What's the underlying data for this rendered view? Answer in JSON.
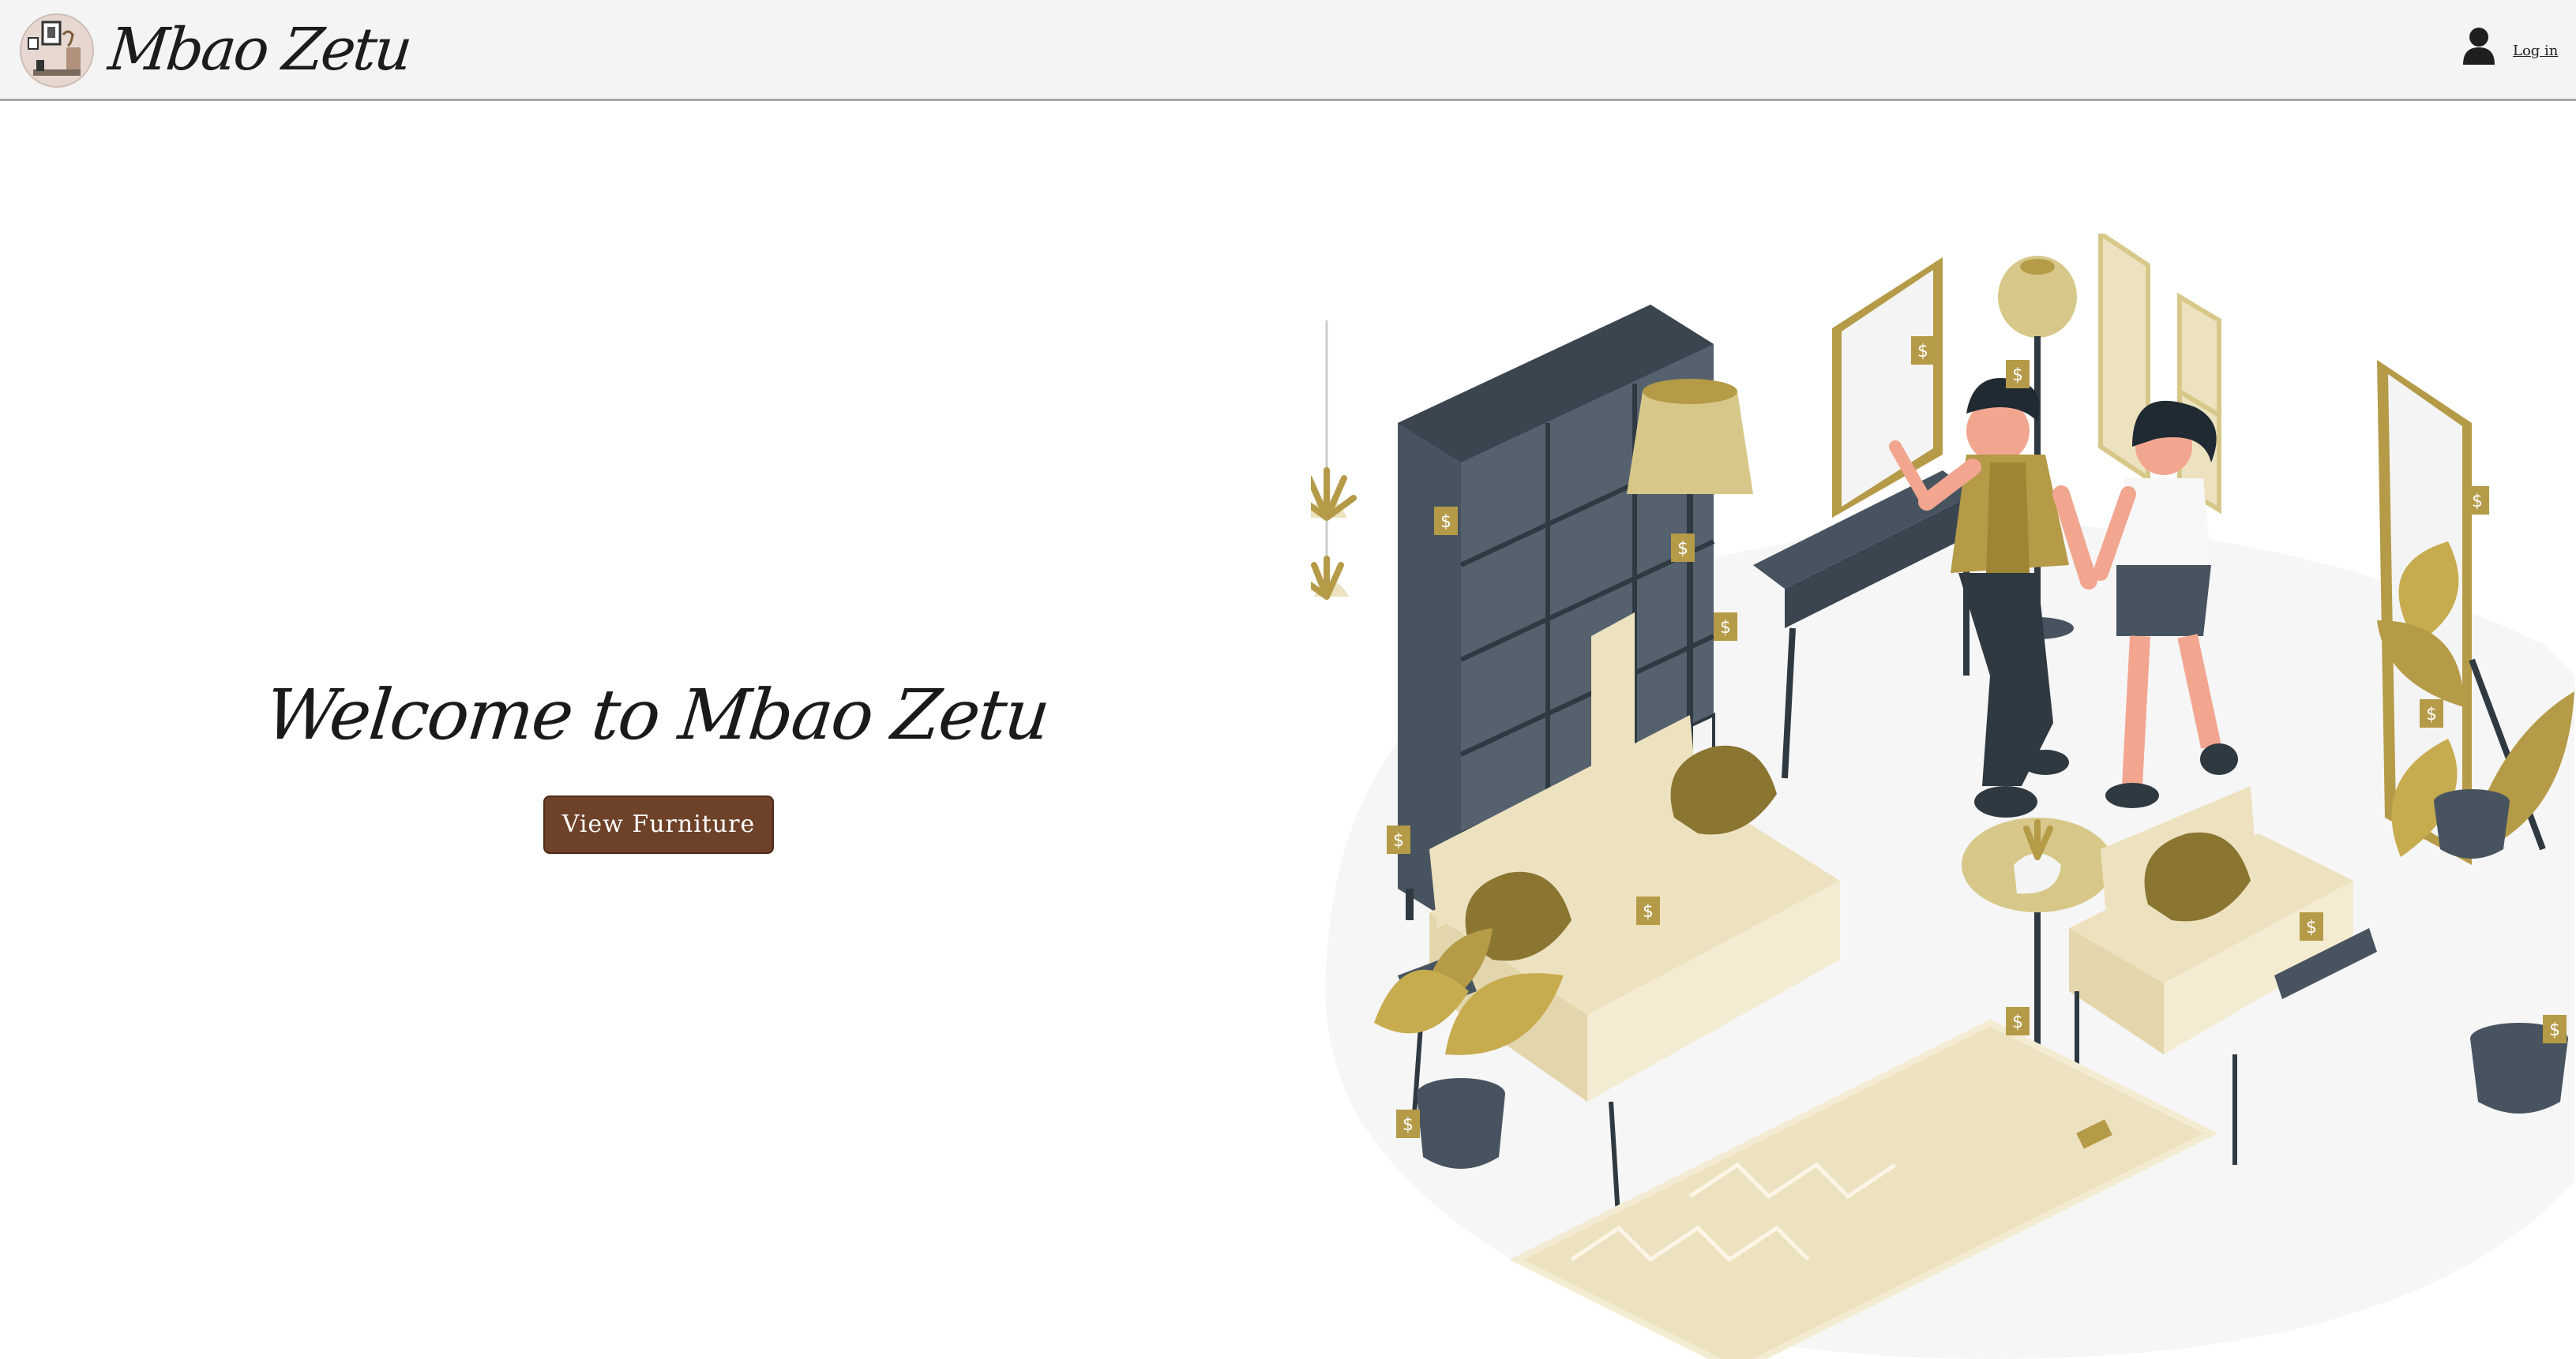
{
  "header": {
    "brand": "Mbao Zetu",
    "login_label": "Log in",
    "icons": {
      "logo": "shop-logo-icon",
      "user": "user-account-icon"
    }
  },
  "hero": {
    "title": "Welcome to Mbao Zetu",
    "cta_label": "View Furniture"
  },
  "illustration": {
    "subject": "showroom-illustration",
    "price_tag_symbol": "$"
  },
  "colors": {
    "header_bg": "#f4f4f4",
    "button_bg": "#6e4229",
    "accent_gold": "#b59a47",
    "cream": "#ede2bf",
    "dark_furniture": "#475460"
  }
}
